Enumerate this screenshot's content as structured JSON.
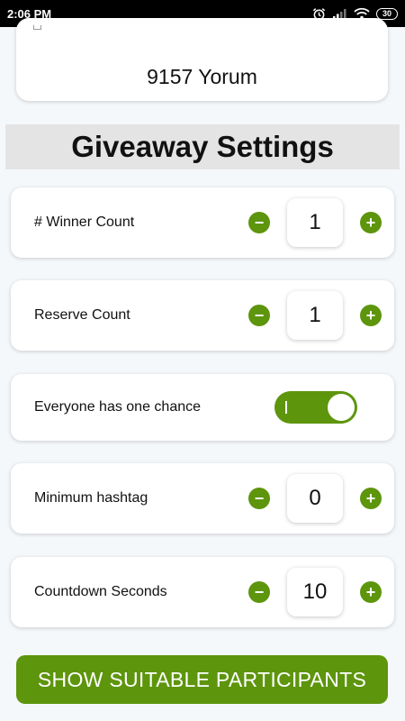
{
  "status_bar": {
    "time": "2:06 PM",
    "battery": "30"
  },
  "top_card": {
    "comment_count": "9157 Yorum"
  },
  "section_title": "Giveaway Settings",
  "settings": {
    "winner_count": {
      "label": "# Winner Count",
      "value": "1",
      "minus": "−",
      "plus": "+"
    },
    "reserve_count": {
      "label": "Reserve Count",
      "value": "1",
      "minus": "−",
      "plus": "+"
    },
    "everyone_one_chance": {
      "label": "Everyone has one chance",
      "enabled": true
    },
    "minimum_hashtag": {
      "label": "Minimum hashtag",
      "value": "0",
      "minus": "−",
      "plus": "+"
    },
    "countdown_seconds": {
      "label": "Countdown Seconds",
      "value": "10",
      "minus": "−",
      "plus": "+"
    }
  },
  "cta": {
    "label": "SHOW SUITABLE PARTICIPANTS"
  },
  "colors": {
    "accent": "#5d950d",
    "section_bg": "#e4e4e4",
    "page_bg": "#f5f8fb"
  }
}
